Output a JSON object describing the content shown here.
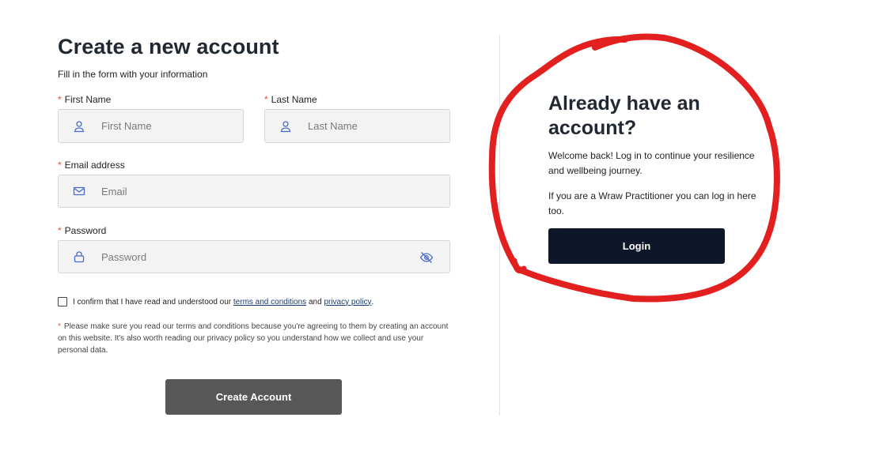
{
  "form": {
    "title": "Create a new account",
    "subtitle": "Fill in the form with your information",
    "required_marker": "*",
    "first_name": {
      "label": "First Name",
      "placeholder": "First Name",
      "value": ""
    },
    "last_name": {
      "label": "Last Name",
      "placeholder": "Last Name",
      "value": ""
    },
    "email": {
      "label": "Email address",
      "placeholder": "Email",
      "value": ""
    },
    "password": {
      "label": "Password",
      "placeholder": "Password",
      "value": ""
    },
    "confirm": {
      "prefix": "I confirm that I have read and understood our",
      "terms_link": "terms and conditions",
      "and": "and",
      "privacy_link": "privacy policy",
      "suffix": ".",
      "checked": false
    },
    "note": "Please make sure you read our terms and conditions because you're agreeing to them by creating an account on this website. It's also worth reading our privacy policy so you understand how we collect and use your personal data.",
    "submit_label": "Create Account"
  },
  "login_panel": {
    "title": "Already have an account?",
    "text1": "Welcome back! Log in to continue your resilience and wellbeing journey.",
    "text2": "If you are a Wraw Practitioner you can log in here too.",
    "button_label": "Login"
  },
  "colors": {
    "required": "#e0532b",
    "create_button": "#575757",
    "login_button": "#0e1729",
    "annotation": "#e32020",
    "icon": "#4a6ad0"
  },
  "icons": {
    "name_fields": "user-icon",
    "email_field": "mail-icon",
    "password_field": "lock-icon",
    "password_toggle": "eye-off-icon"
  }
}
